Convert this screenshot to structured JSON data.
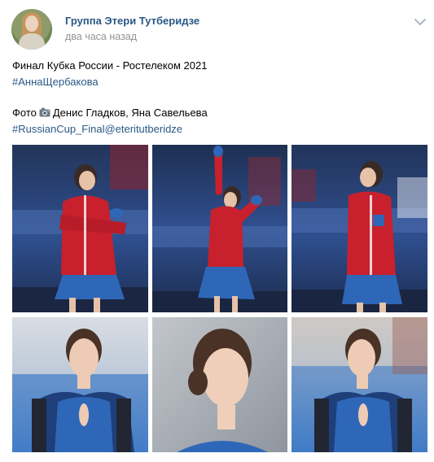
{
  "post": {
    "group_name": "Группа Этери Тутберидзе",
    "time": "два часа назад",
    "line1": "Финал Кубка России - Ростелеком 2021",
    "hashtag1": "#АннаЩербакова",
    "photo_prefix": "Фото",
    "photo_authors": "Денис Гладков, Яна Савельева",
    "hashtag2": "#RussianCup_Final@eteritutberidze"
  },
  "icons": {
    "menu": "chevron-down-icon",
    "camera": "camera-emoji-icon"
  },
  "colors": {
    "link": "#2a5885",
    "meta": "#939393",
    "jacket": "#c8202d",
    "dress": "#2f67b8"
  }
}
